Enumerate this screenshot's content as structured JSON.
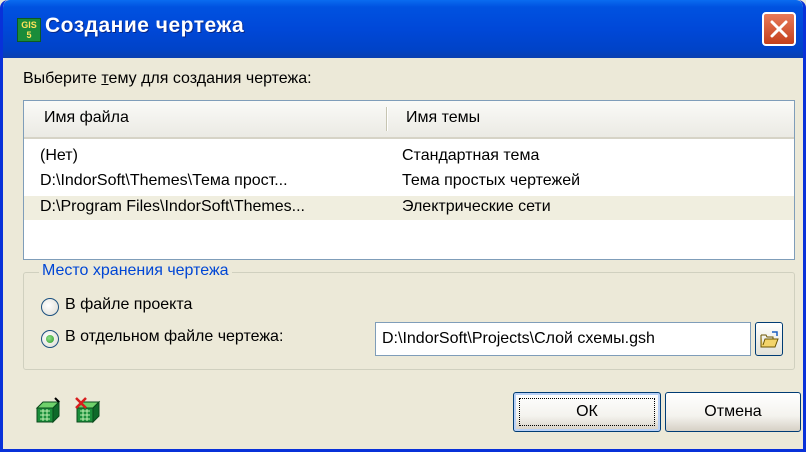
{
  "window": {
    "title": "Создание чертежа",
    "app_icon_text": [
      "GIS",
      "5"
    ]
  },
  "prompt": {
    "prefix": "Выберите ",
    "underlined": "т",
    "suffix": "ему для создания чертежа:"
  },
  "listview": {
    "columns": [
      "Имя файла",
      "Имя темы"
    ],
    "rows": [
      {
        "file": "(Нет)",
        "theme": "Стандартная тема",
        "selected": false
      },
      {
        "file": "D:\\IndorSoft\\Themes\\Тема прост...",
        "theme": "Тема простых чертежей",
        "selected": false
      },
      {
        "file": "D:\\Program Files\\IndorSoft\\Themes...",
        "theme": "Электрические сети",
        "selected": true
      }
    ]
  },
  "storage": {
    "legend": "Место хранения чертежа",
    "option_project": "В файле проекта",
    "option_separate": "В отдельном файле чертежа:",
    "selected": "separate",
    "path_value": "D:\\IndorSoft\\Projects\\Слой схемы.gsh"
  },
  "buttons": {
    "ok": "ОК",
    "cancel": "Отмена"
  },
  "icons": {
    "title_app": "gis-app-icon",
    "close": "close-icon",
    "browse": "open-folder-icon",
    "tool1": "add-theme-icon",
    "tool2": "delete-theme-icon"
  },
  "colors": {
    "titlebar": "#0048d8",
    "legend_text": "#0046d5",
    "close_button": "#d9542b"
  }
}
